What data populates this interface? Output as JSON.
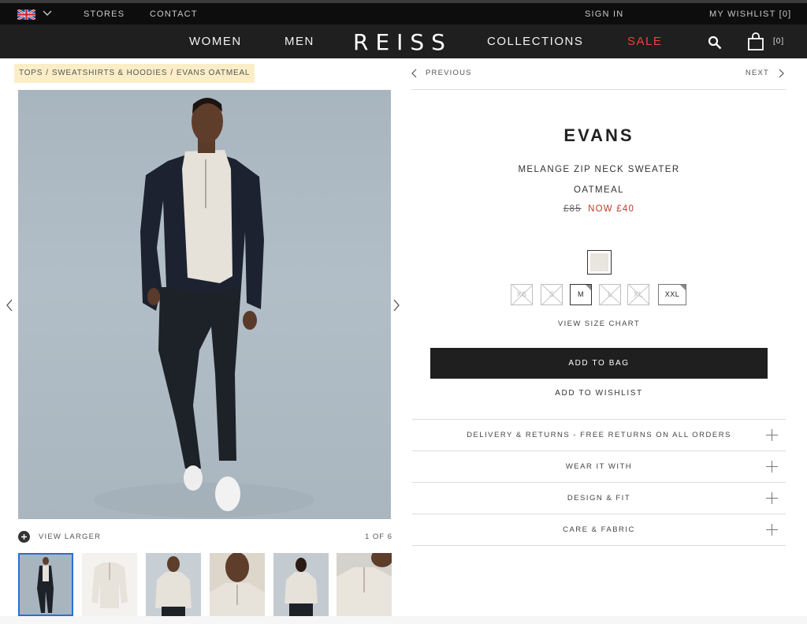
{
  "util_bar": {
    "stores": "STORES",
    "contact": "CONTACT",
    "sign_in": "SIGN IN",
    "wishlist": "MY WISHLIST [0]",
    "flag_icon": "uk-flag-icon"
  },
  "nav": {
    "women": "WOMEN",
    "men": "MEN",
    "logo": "REISS",
    "collections": "COLLECTIONS",
    "sale": "SALE",
    "bag_count": "[0]",
    "sale_color": "#e8453c"
  },
  "breadcrumb": {
    "items": [
      "TOPS",
      "SWEATSHIRTS & HOODIES",
      "EVANS OATMEAL"
    ],
    "separator": "/"
  },
  "gallery": {
    "view_larger": "VIEW LARGER",
    "count": "1 OF 6",
    "thumbnail_count": 6
  },
  "product_nav": {
    "previous": "PREVIOUS",
    "next": "NEXT"
  },
  "product": {
    "name": "EVANS",
    "subtitle": "MELANGE ZIP NECK SWEATER",
    "color": "OATMEAL",
    "old_price": "£85",
    "now_price": "NOW £40",
    "swatch_color": "#e9e5df"
  },
  "sizes": [
    {
      "label": "XS",
      "available": false
    },
    {
      "label": "S",
      "available": false
    },
    {
      "label": "M",
      "available": true
    },
    {
      "label": "L",
      "available": false
    },
    {
      "label": "XL",
      "available": false
    },
    {
      "label": "XXL",
      "available": true
    }
  ],
  "actions": {
    "size_chart": "VIEW SIZE CHART",
    "add_to_bag": "ADD TO BAG",
    "add_to_wishlist": "ADD TO WISHLIST"
  },
  "accordion": [
    {
      "label": "DELIVERY & RETURNS - FREE RETURNS ON ALL ORDERS"
    },
    {
      "label": "WEAR IT WITH"
    },
    {
      "label": "DESIGN & FIT"
    },
    {
      "label": "CARE & FABRIC"
    }
  ]
}
